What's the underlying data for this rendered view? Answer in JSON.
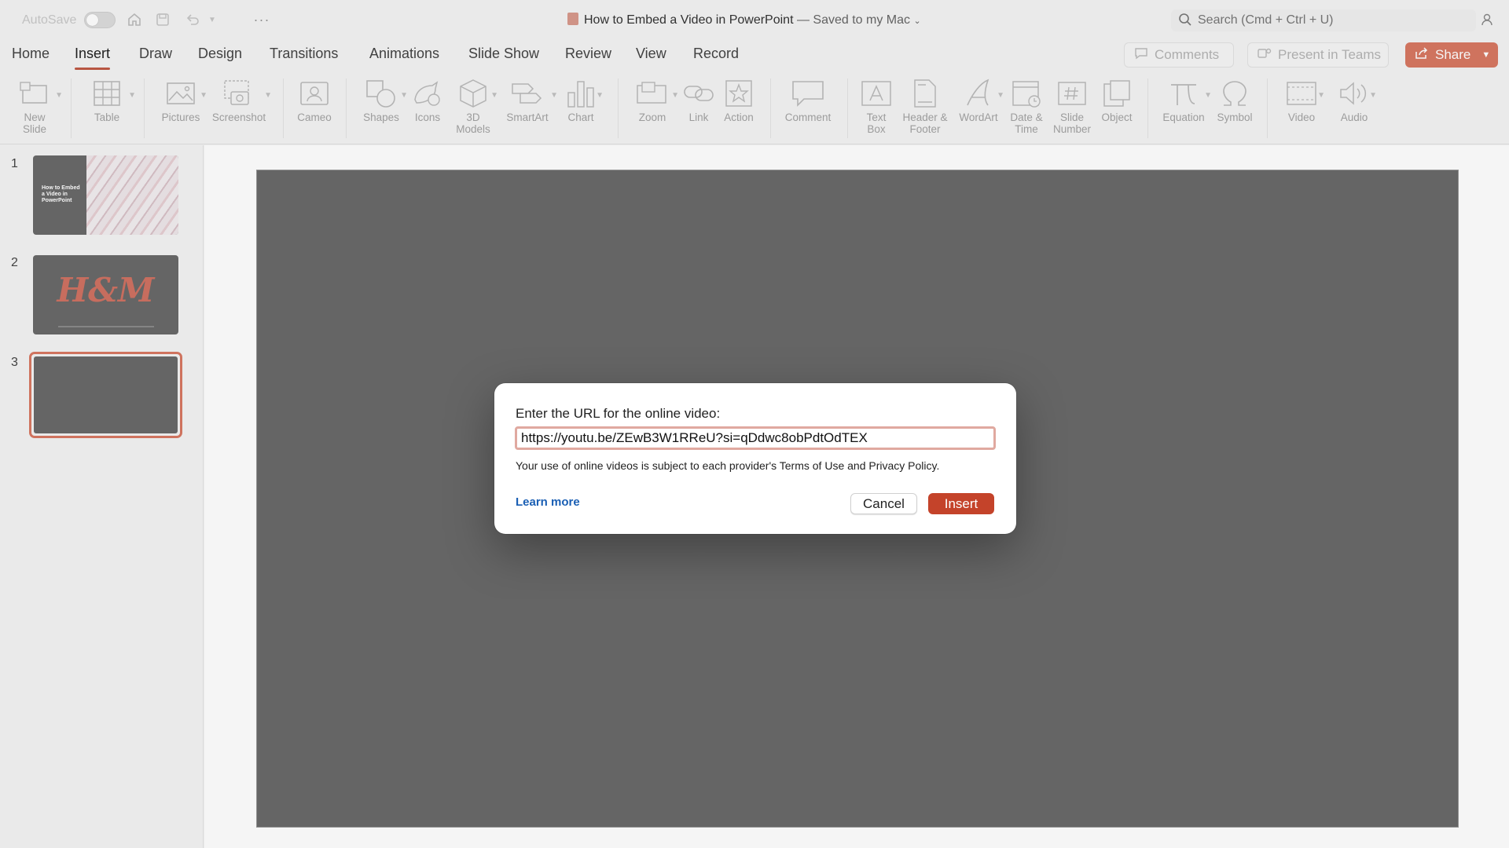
{
  "titlebar": {
    "autosave_label": "AutoSave",
    "doc_title": "How to Embed a Video in PowerPoint",
    "doc_status": " — Saved to my Mac",
    "search_placeholder": "Search (Cmd + Ctrl + U)"
  },
  "tabs": [
    "Home",
    "Insert",
    "Draw",
    "Design",
    "Transitions",
    "Animations",
    "Slide Show",
    "Review",
    "View",
    "Record"
  ],
  "active_tab": "Insert",
  "actions": {
    "comments": "Comments",
    "present_teams": "Present in Teams",
    "share": "Share"
  },
  "ribbon": {
    "new_slide": "New\nSlide",
    "table": "Table",
    "pictures": "Pictures",
    "screenshot": "Screenshot",
    "cameo": "Cameo",
    "shapes": "Shapes",
    "icons": "Icons",
    "models_3d": "3D\nModels",
    "smartart": "SmartArt",
    "chart": "Chart",
    "zoom": "Zoom",
    "link": "Link",
    "action": "Action",
    "comment": "Comment",
    "text_box": "Text\nBox",
    "header_footer": "Header &\nFooter",
    "wordart": "WordArt",
    "date_time": "Date &\nTime",
    "slide_number": "Slide\nNumber",
    "object": "Object",
    "equation": "Equation",
    "symbol": "Symbol",
    "video": "Video",
    "audio": "Audio"
  },
  "slides": [
    {
      "number": "1",
      "title": "How to Embed a Video in PowerPoint"
    },
    {
      "number": "2",
      "logo": "H&M"
    },
    {
      "number": "3"
    }
  ],
  "selected_slide": "3",
  "dialog": {
    "prompt": "Enter the URL for the online video:",
    "url_value": "https://youtu.be/ZEwB3W1RReU?si=qDdwc8obPdtOdTEX",
    "note": "Your use of online videos is subject to each provider's Terms of Use and Privacy Policy.",
    "learn_more": "Learn more",
    "cancel": "Cancel",
    "insert": "Insert"
  },
  "colors": {
    "accent": "#c05a45",
    "insert_button": "#c4432a",
    "link": "#1a5fb4",
    "slide_bg": "#6a6a6a"
  }
}
